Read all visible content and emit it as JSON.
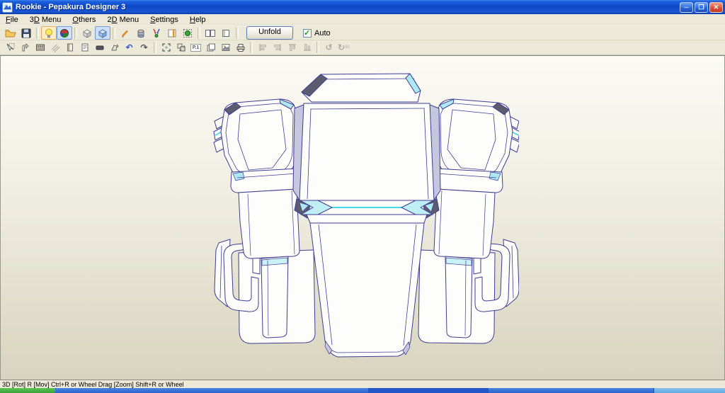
{
  "window": {
    "title": "Rookie - Pepakura Designer 3",
    "controls": {
      "minimize": "minimize",
      "maximize": "maximize",
      "close": "close"
    }
  },
  "menu": {
    "items": [
      {
        "label": "File",
        "accel": 0
      },
      {
        "label": "3D Menu",
        "accel": 1
      },
      {
        "label": "Others",
        "accel": 0
      },
      {
        "label": "2D Menu",
        "accel": 1
      },
      {
        "label": "Settings",
        "accel": 0
      },
      {
        "label": "Help",
        "accel": 0
      }
    ]
  },
  "toolbar_main": {
    "items": [
      {
        "name": "open-file",
        "pressed": false
      },
      {
        "name": "save-file",
        "pressed": false
      },
      {
        "name": "toggle-light",
        "pressed": true
      },
      {
        "name": "toggle-material-colors",
        "pressed": true
      },
      {
        "name": "view-wireframe-box",
        "pressed": false
      },
      {
        "name": "view-shaded-box",
        "pressed": true
      },
      {
        "name": "edit-pen",
        "pressed": false
      },
      {
        "name": "3d-object-cylinder",
        "pressed": false
      },
      {
        "name": "drop-to-ground",
        "pressed": false
      },
      {
        "name": "panel-divider",
        "pressed": false
      },
      {
        "name": "select-object",
        "pressed": false
      },
      {
        "name": "split-view",
        "pressed": false
      },
      {
        "name": "single-view",
        "pressed": false
      }
    ],
    "unfold_label": "Unfold",
    "auto_label": "Auto",
    "auto_checked": true
  },
  "toolbar_2d": {
    "items": [
      {
        "name": "select-parts",
        "enabled": true
      },
      {
        "name": "edit-flaps",
        "enabled": true
      },
      {
        "name": "texture-stamp",
        "enabled": true
      },
      {
        "name": "fold-lines",
        "enabled": false
      },
      {
        "name": "sheet-pages",
        "enabled": true
      },
      {
        "name": "page-layout",
        "enabled": true
      },
      {
        "name": "eraser",
        "enabled": true
      },
      {
        "name": "rotate-part",
        "enabled": true
      },
      {
        "name": "undo",
        "enabled": true
      },
      {
        "name": "redo",
        "enabled": true
      },
      {
        "name": "zoom-marquee",
        "enabled": true
      },
      {
        "name": "move-parts",
        "enabled": true
      },
      {
        "name": "page-number",
        "enabled": true,
        "label": "P.1"
      },
      {
        "name": "arrange-sheets",
        "enabled": true
      },
      {
        "name": "export-image",
        "enabled": true
      },
      {
        "name": "print",
        "enabled": true
      },
      {
        "name": "align-left",
        "enabled": false
      },
      {
        "name": "align-right",
        "enabled": false
      },
      {
        "name": "align-top",
        "enabled": false
      },
      {
        "name": "align-bottom",
        "enabled": false
      },
      {
        "name": "rotate-ccw",
        "enabled": false
      },
      {
        "name": "rotate-90",
        "enabled": false,
        "label": "90"
      }
    ]
  },
  "viewport": {
    "content": "3D wireframe model of a symmetric mech chest / backpack armor piece"
  },
  "statusbar": {
    "text": "3D [Rot] R [Mov] Ctrl+R or Wheel Drag [Zoom] Shift+R or Wheel"
  },
  "colors": {
    "titlebar_blue": "#1d5fdd",
    "chrome_beige": "#ece9d8",
    "model_line": "#3d3d94",
    "model_accent_cyan": "#45d5e6",
    "taskbar_green": "#37a33c",
    "taskbar_blue": "#2a63cf"
  }
}
